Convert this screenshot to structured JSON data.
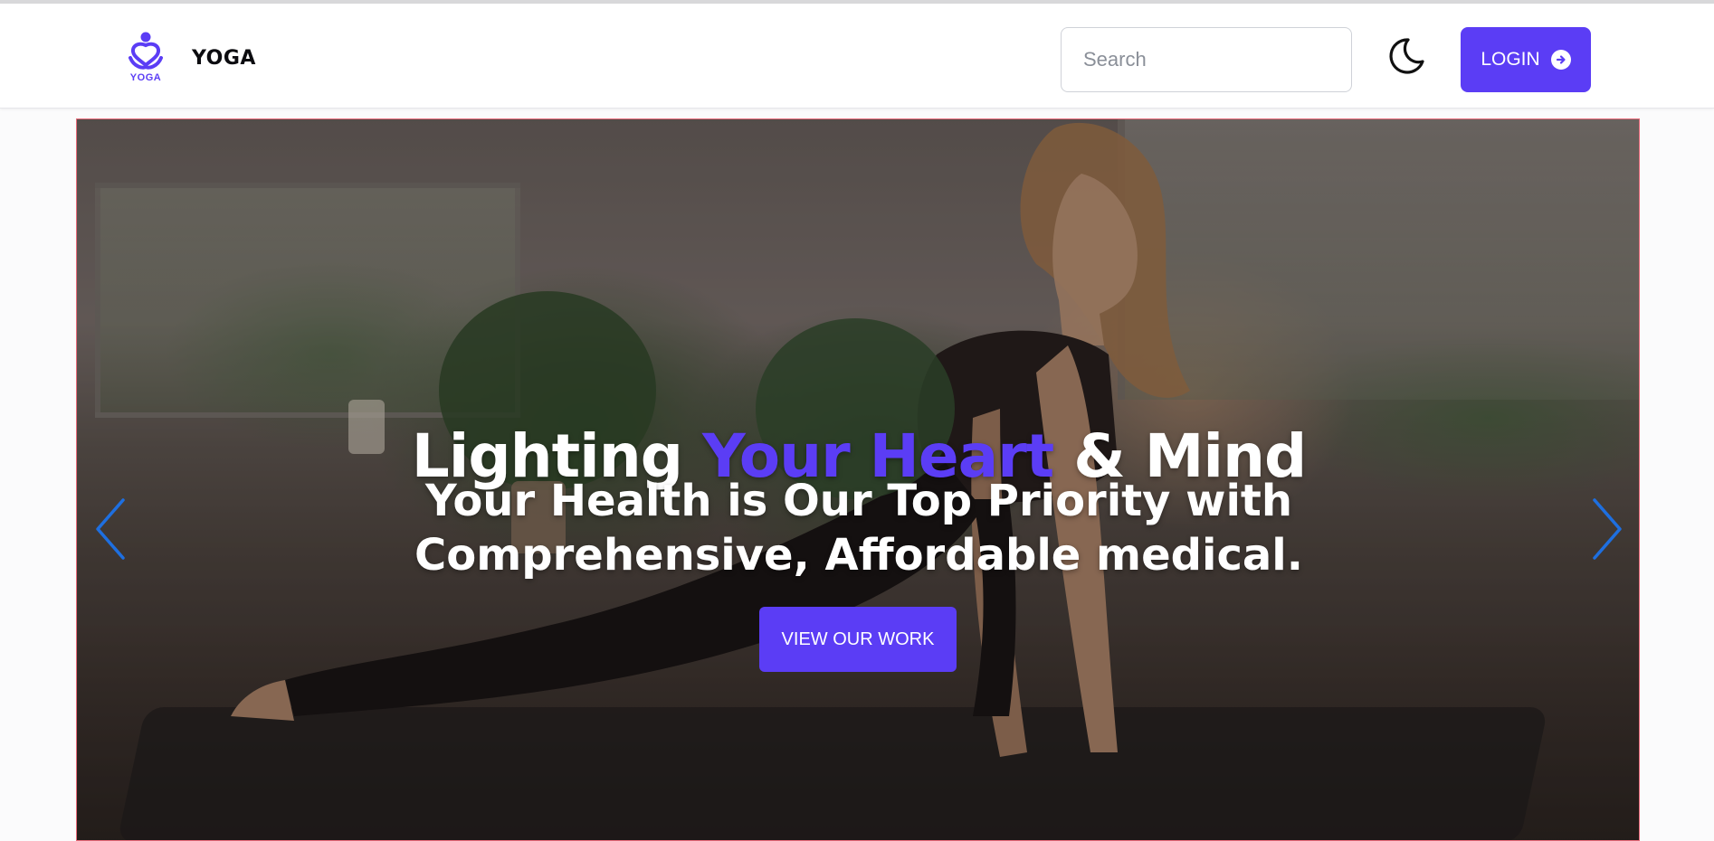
{
  "brand": {
    "logo_text": "YOGA",
    "name": "YOGA"
  },
  "header": {
    "search_placeholder": "Search",
    "theme_icon": "moon-icon",
    "login_label": "LOGIN",
    "login_icon": "arrow-circle-right-icon"
  },
  "hero": {
    "title_part1": "Lighting ",
    "title_accent": "Your Heart",
    "title_part2": " & Mind",
    "subtitle": "Your Health is Our Top Priority with Comprehensive, Affordable medical.",
    "cta_label": "VIEW OUR WORK",
    "prev_icon": "chevron-left-icon",
    "next_icon": "chevron-right-icon"
  },
  "colors": {
    "accent": "#5b3df5",
    "carousel_arrow": "#1e6fe0"
  }
}
